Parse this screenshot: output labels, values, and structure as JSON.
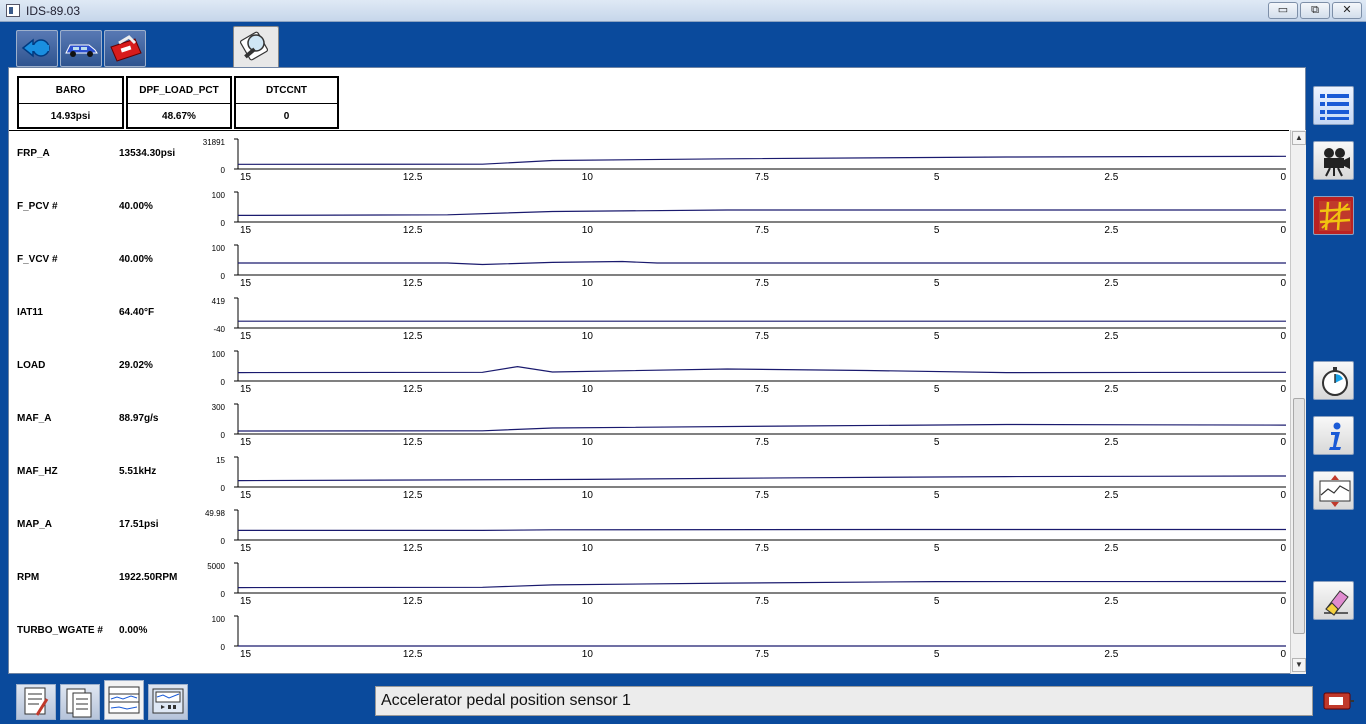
{
  "window": {
    "title": "IDS-89.03",
    "minimize": "▭",
    "restore": "⧉",
    "close": "✕"
  },
  "toolbar": {
    "buttons": [
      {
        "name": "back-arrow-icon"
      },
      {
        "name": "vehicle-icon"
      },
      {
        "name": "toolbox-icon"
      },
      {
        "name": "datalogger-icon",
        "active": true
      }
    ]
  },
  "pid_boxes": [
    {
      "name": "BARO",
      "value": "14.93psi"
    },
    {
      "name": "DPF_LOAD_PCT",
      "value": "48.67%"
    },
    {
      "name": "DTCCNT",
      "value": "0"
    }
  ],
  "x_ticks": [
    "15",
    "12.5",
    "10",
    "7.5",
    "5",
    "2.5",
    "0"
  ],
  "rows": [
    {
      "label": "FRP_A",
      "value": "13534.30psi",
      "ymax": "31891",
      "ymin": "0",
      "series": [
        {
          "t": 15,
          "v": 5000
        },
        {
          "t": 11.5,
          "v": 5100
        },
        {
          "t": 10.5,
          "v": 9000
        },
        {
          "t": 8,
          "v": 10800
        },
        {
          "t": 4,
          "v": 12800
        },
        {
          "t": 0,
          "v": 13534
        }
      ]
    },
    {
      "label": "F_PCV #",
      "value": "40.00%",
      "ymax": "100",
      "ymin": "0",
      "series": [
        {
          "t": 15,
          "v": 22
        },
        {
          "t": 12,
          "v": 24
        },
        {
          "t": 10.5,
          "v": 35
        },
        {
          "t": 8,
          "v": 40
        },
        {
          "t": 0,
          "v": 40
        }
      ]
    },
    {
      "label": "F_VCV #",
      "value": "40.00%",
      "ymax": "100",
      "ymin": "0",
      "series": [
        {
          "t": 15,
          "v": 40
        },
        {
          "t": 12,
          "v": 40
        },
        {
          "t": 11.5,
          "v": 35
        },
        {
          "t": 10.5,
          "v": 42
        },
        {
          "t": 9.5,
          "v": 45
        },
        {
          "t": 9,
          "v": 40
        },
        {
          "t": 0,
          "v": 40
        }
      ]
    },
    {
      "label": "IAT11",
      "value": "64.40°F",
      "ymax": "419",
      "ymin": "-40",
      "series": [
        {
          "t": 15,
          "v": 64
        },
        {
          "t": 0,
          "v": 64
        }
      ]
    },
    {
      "label": "LOAD",
      "value": "29.02%",
      "ymax": "100",
      "ymin": "0",
      "series": [
        {
          "t": 15,
          "v": 28
        },
        {
          "t": 11.5,
          "v": 29
        },
        {
          "t": 11,
          "v": 48
        },
        {
          "t": 10.5,
          "v": 30
        },
        {
          "t": 8,
          "v": 40
        },
        {
          "t": 6,
          "v": 35
        },
        {
          "t": 4,
          "v": 28
        },
        {
          "t": 0,
          "v": 29
        }
      ]
    },
    {
      "label": "MAF_A",
      "value": "88.97g/s",
      "ymax": "300",
      "ymin": "0",
      "series": [
        {
          "t": 15,
          "v": 30
        },
        {
          "t": 11.5,
          "v": 32
        },
        {
          "t": 10.5,
          "v": 60
        },
        {
          "t": 7,
          "v": 80
        },
        {
          "t": 4,
          "v": 95
        },
        {
          "t": 0,
          "v": 89
        }
      ]
    },
    {
      "label": "MAF_HZ",
      "value": "5.51kHz",
      "ymax": "15",
      "ymin": "0",
      "series": [
        {
          "t": 15,
          "v": 3.2
        },
        {
          "t": 10,
          "v": 3.8
        },
        {
          "t": 7,
          "v": 4.6
        },
        {
          "t": 4,
          "v": 5.2
        },
        {
          "t": 0,
          "v": 5.51
        }
      ]
    },
    {
      "label": "MAP_A",
      "value": "17.51psi",
      "ymax": "49.98",
      "ymin": "0",
      "series": [
        {
          "t": 15,
          "v": 16
        },
        {
          "t": 11.5,
          "v": 16
        },
        {
          "t": 10.5,
          "v": 17
        },
        {
          "t": 5,
          "v": 17.5
        },
        {
          "t": 0,
          "v": 17.51
        }
      ]
    },
    {
      "label": "RPM",
      "value": "1922.50RPM",
      "ymax": "5000",
      "ymin": "0",
      "series": [
        {
          "t": 15,
          "v": 900
        },
        {
          "t": 11.5,
          "v": 950
        },
        {
          "t": 10.5,
          "v": 1350
        },
        {
          "t": 8,
          "v": 1650
        },
        {
          "t": 5,
          "v": 1900
        },
        {
          "t": 0,
          "v": 1922
        }
      ]
    },
    {
      "label": "TURBO_WGATE #",
      "value": "0.00%",
      "ymax": "100",
      "ymin": "0",
      "series": [
        {
          "t": 15,
          "v": 0
        },
        {
          "t": 0,
          "v": 0
        }
      ]
    }
  ],
  "status_text": "Accelerator pedal position sensor 1",
  "colors": {
    "trace": "#1a1a6e",
    "frame": "#0a4a9c"
  }
}
